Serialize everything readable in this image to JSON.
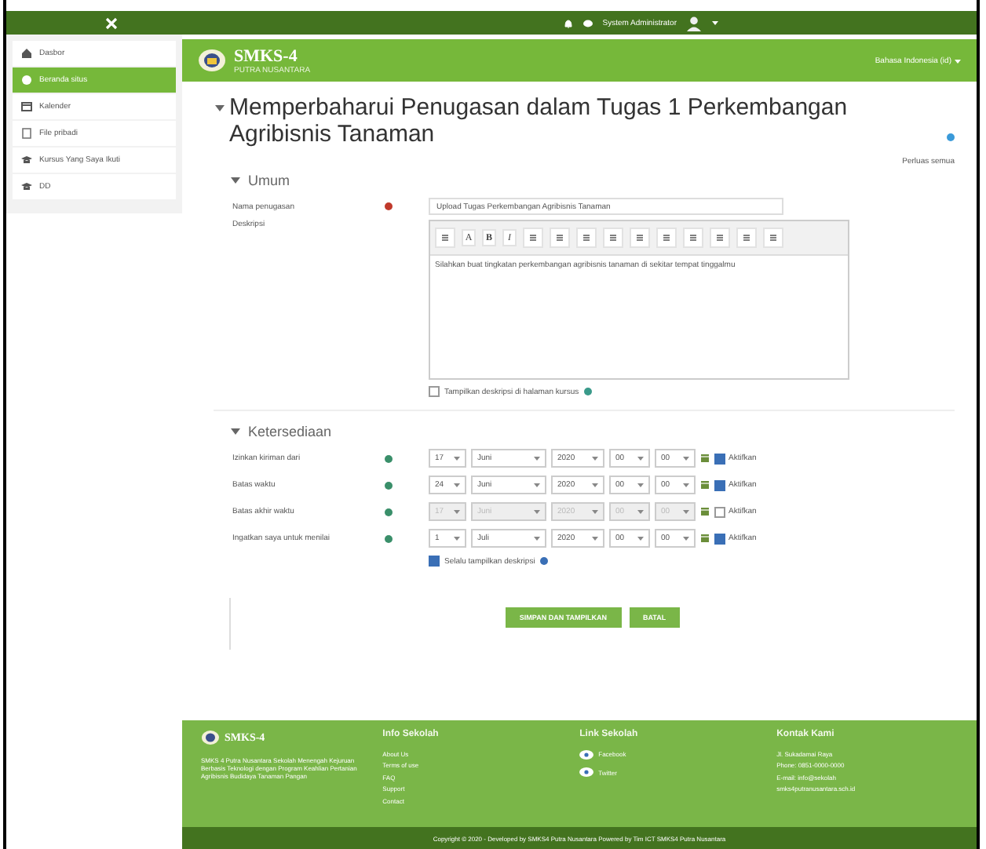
{
  "topbar": {
    "user": "System Administrator"
  },
  "sidebar": {
    "items": [
      {
        "label": "Dasbor",
        "selected": false
      },
      {
        "label": "Beranda situs",
        "selected": true
      },
      {
        "label": "Kalender",
        "selected": false
      },
      {
        "label": "File pribadi",
        "selected": false
      },
      {
        "label": "Kursus Yang Saya Ikuti",
        "selected": false
      },
      {
        "label": "DD",
        "selected": false
      }
    ]
  },
  "header": {
    "logo": "SMKS-4",
    "tagline": "PUTRA NUSANTARA",
    "language": "Bahasa Indonesia (id)"
  },
  "page": {
    "title": "Memperbaharui Penugasan dalam Tugas 1 Perkembangan Agribisnis Tanaman",
    "expand_all": "Perluas semua"
  },
  "general": {
    "title": "Umum",
    "expanded": true,
    "name_label": "Nama penugasan",
    "name_value": "Upload Tugas Perkembangan Agribisnis Tanaman",
    "description_label": "Deskripsi",
    "toolbar": [
      {
        "kind": "icon"
      },
      {
        "kind": "text",
        "text": "A"
      },
      {
        "kind": "text",
        "text": "B"
      },
      {
        "kind": "text",
        "text": "I"
      },
      {
        "kind": "icon"
      },
      {
        "kind": "icon"
      },
      {
        "kind": "icon"
      },
      {
        "kind": "icon"
      },
      {
        "kind": "icon"
      },
      {
        "kind": "icon"
      },
      {
        "kind": "icon"
      },
      {
        "kind": "icon"
      },
      {
        "kind": "icon"
      },
      {
        "kind": "icon"
      }
    ],
    "description": "Silahkan buat tingkatan perkembangan agribisnis tanaman di sekitar tempat tinggalmu",
    "show_description": {
      "label": "Tampilkan deskripsi di halaman kursus",
      "checked": false
    }
  },
  "availability": {
    "title": "Ketersediaan",
    "expanded": true,
    "rows": [
      {
        "label": "Izinkan kiriman dari",
        "day": "17",
        "month": "Juni",
        "year": "2020",
        "hour": "00",
        "minute": "00",
        "enable_label": "Aktifkan",
        "enabled": true
      },
      {
        "label": "Batas waktu",
        "day": "24",
        "month": "Juni",
        "year": "2020",
        "hour": "00",
        "minute": "00",
        "enable_label": "Aktifkan",
        "enabled": true
      },
      {
        "label": "Batas akhir waktu",
        "day": "17",
        "month": "Juni",
        "year": "2020",
        "hour": "00",
        "minute": "00",
        "enable_label": "Aktifkan",
        "enabled": false
      },
      {
        "label": "Ingatkan saya untuk menilai",
        "day": "1",
        "month": "Juli",
        "year": "2020",
        "hour": "00",
        "minute": "00",
        "enable_label": "Aktifkan",
        "enabled": true
      }
    ],
    "always_show": {
      "label": "Selalu tampilkan deskripsi",
      "checked": true
    }
  },
  "buttons": [
    "SIMPAN DAN TAMPILKAN",
    "BATAL"
  ],
  "footer": {
    "logo": "SMKS-4",
    "about": "SMKS 4 Putra Nusantara Sekolah Menengah Kejuruan Berbasis Teknologi dengan Program Keahlian Pertanian Agribisnis Budidaya Tanaman Pangan",
    "columns": [
      {
        "title": "Info Sekolah",
        "links": [
          "About Us",
          "Terms of use",
          "FAQ",
          "Support",
          "Contact"
        ]
      },
      {
        "title": "Link Sekolah",
        "links": [
          "Facebook",
          "Twitter"
        ]
      },
      {
        "title": "Kontak Kami",
        "links": [
          "Jl. Sukadamai Raya",
          "Phone: 0851-0000-0000",
          "E-mail: info@sekolah",
          "smks4putranusantara.sch.id"
        ]
      }
    ],
    "copyright": "Copyright © 2020 - Developed by SMKS4 Putra Nusantara Powered by Tim ICT SMKS4 Putra Nusantara"
  }
}
